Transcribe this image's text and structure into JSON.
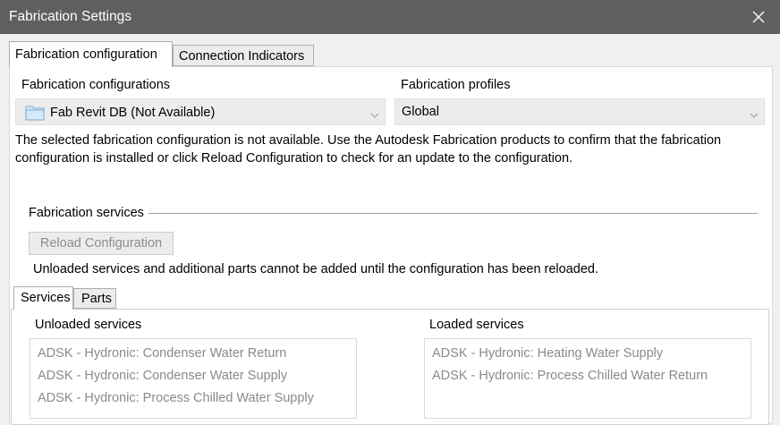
{
  "window": {
    "title": "Fabrication Settings"
  },
  "tabs": {
    "fabrication_configuration": "Fabrication configuration",
    "connection_indicators": "Connection Indicators"
  },
  "config": {
    "configurations_label": "Fabrication configurations",
    "configuration_value": "Fab Revit DB (Not Available)",
    "profiles_label": "Fabrication profiles",
    "profile_value": "Global",
    "message_line1": "The selected fabrication configuration is not available. Use the Autodesk Fabrication products to confirm that the fabrication",
    "message_line2": "configuration is installed or click Reload Configuration to check for an update to the configuration."
  },
  "services_section": {
    "title": "Fabrication services",
    "reload_button": "Reload Configuration",
    "reload_note": "Unloaded services and additional parts cannot be added until the configuration has been reloaded."
  },
  "subtabs": {
    "services": "Services",
    "parts": "Parts"
  },
  "unloaded": {
    "label": "Unloaded services",
    "items": [
      "ADSK - Hydronic: Condenser Water Return",
      "ADSK - Hydronic: Condenser Water Supply",
      "ADSK - Hydronic: Process Chilled Water Supply"
    ]
  },
  "loaded": {
    "label": "Loaded services",
    "items": [
      "ADSK - Hydronic: Heating Water Supply",
      "ADSK - Hydronic: Process Chilled Water Return"
    ]
  },
  "icons": {
    "close": "close-icon",
    "folder": "folder-icon",
    "dropdown": "chevron-down-icon"
  }
}
